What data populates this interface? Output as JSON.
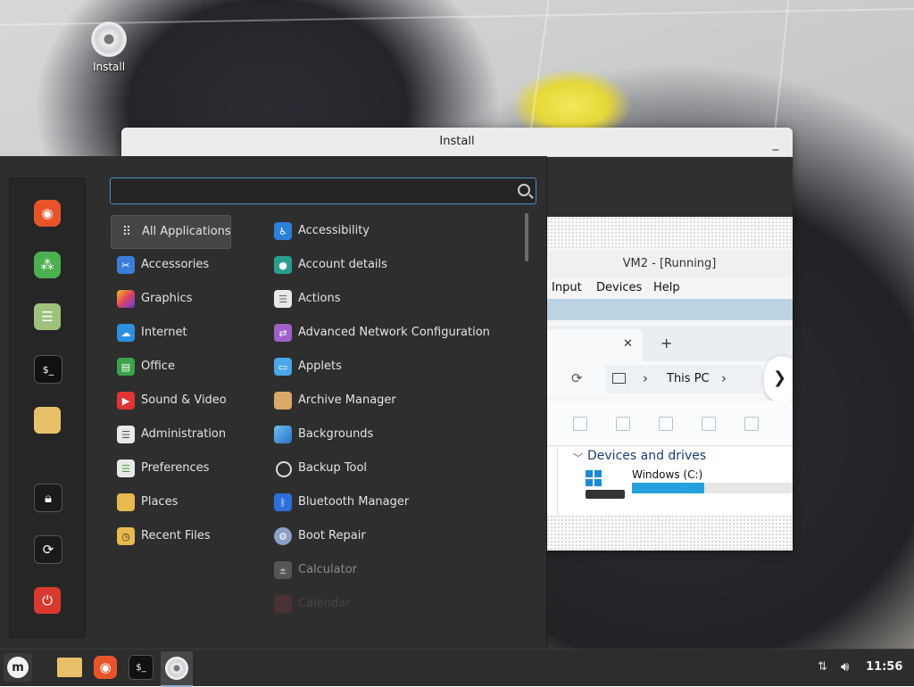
{
  "desktop": {
    "icon_label": "Install"
  },
  "install_window": {
    "title": "Install",
    "vm": {
      "title": "VM2 - [Running]",
      "menu": [
        "Input",
        "Devices",
        "Help"
      ],
      "tab_close": "✕",
      "tab_new": "+",
      "breadcrumb": "This PC",
      "breadcrumb_sep": "›",
      "nav_next": "❯",
      "section_title": "Devices and drives",
      "drive_label": "Windows (C:)",
      "drive_usage_fraction": 0.45
    }
  },
  "menu": {
    "search": {
      "value": "",
      "placeholder": ""
    },
    "favorites": [
      {
        "name": "firefox-icon",
        "color": "#e8542a"
      },
      {
        "name": "mint-install-icon",
        "color": "#4caf50"
      },
      {
        "name": "settings-toggle-icon",
        "color": "#7cb36b"
      },
      {
        "name": "terminal-icon",
        "color": "#1a1a1a"
      },
      {
        "name": "folder-icon",
        "color": "#e8c06a"
      },
      {
        "name": "lock-icon",
        "color": "#1a1a1a"
      },
      {
        "name": "logout-icon",
        "color": "#1a1a1a"
      },
      {
        "name": "power-icon",
        "color": "#d93a2f"
      }
    ],
    "categories": [
      {
        "label": "All Applications",
        "icon": "grid-icon"
      },
      {
        "label": "Accessories",
        "icon": "scissors-icon"
      },
      {
        "label": "Graphics",
        "icon": "graphics-icon"
      },
      {
        "label": "Internet",
        "icon": "cloud-icon"
      },
      {
        "label": "Office",
        "icon": "office-icon"
      },
      {
        "label": "Sound & Video",
        "icon": "play-icon"
      },
      {
        "label": "Administration",
        "icon": "admin-icon"
      },
      {
        "label": "Preferences",
        "icon": "preferences-icon"
      },
      {
        "label": "Places",
        "icon": "folder-icon"
      },
      {
        "label": "Recent Files",
        "icon": "recent-folder-icon"
      }
    ],
    "apps": [
      {
        "label": "Accessibility",
        "icon": "accessibility-icon"
      },
      {
        "label": "Account details",
        "icon": "account-icon"
      },
      {
        "label": "Actions",
        "icon": "actions-icon"
      },
      {
        "label": "Advanced Network Configuration",
        "icon": "network-icon"
      },
      {
        "label": "Applets",
        "icon": "applets-icon"
      },
      {
        "label": "Archive Manager",
        "icon": "archive-icon"
      },
      {
        "label": "Backgrounds",
        "icon": "backgrounds-icon"
      },
      {
        "label": "Backup Tool",
        "icon": "backup-icon"
      },
      {
        "label": "Bluetooth Manager",
        "icon": "bluetooth-icon"
      },
      {
        "label": "Boot Repair",
        "icon": "boot-repair-icon"
      },
      {
        "label": "Calculator",
        "icon": "calculator-icon"
      },
      {
        "label": "Calendar",
        "icon": "calendar-icon"
      }
    ]
  },
  "taskbar": {
    "clock": "11:56"
  },
  "colors": {
    "accent": "#4a90c0",
    "menu_bg": "#2e2e2e",
    "taskbar_bg": "#2d2d2d",
    "drive_bar": "#26a0da"
  }
}
